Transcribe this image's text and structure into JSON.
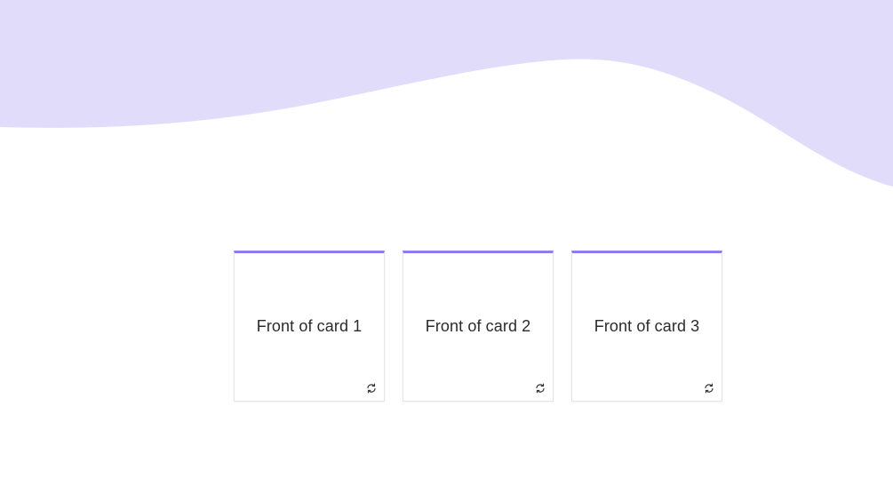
{
  "theme": {
    "wave_color": "#e1dcfa",
    "card_accent_color": "#8e7cf0",
    "background_color": "#ffffff"
  },
  "cards": [
    {
      "front_text": "Front of card 1",
      "flip_icon": "refresh-icon"
    },
    {
      "front_text": "Front of card 2",
      "flip_icon": "refresh-icon"
    },
    {
      "front_text": "Front of card 3",
      "flip_icon": "refresh-icon"
    }
  ]
}
